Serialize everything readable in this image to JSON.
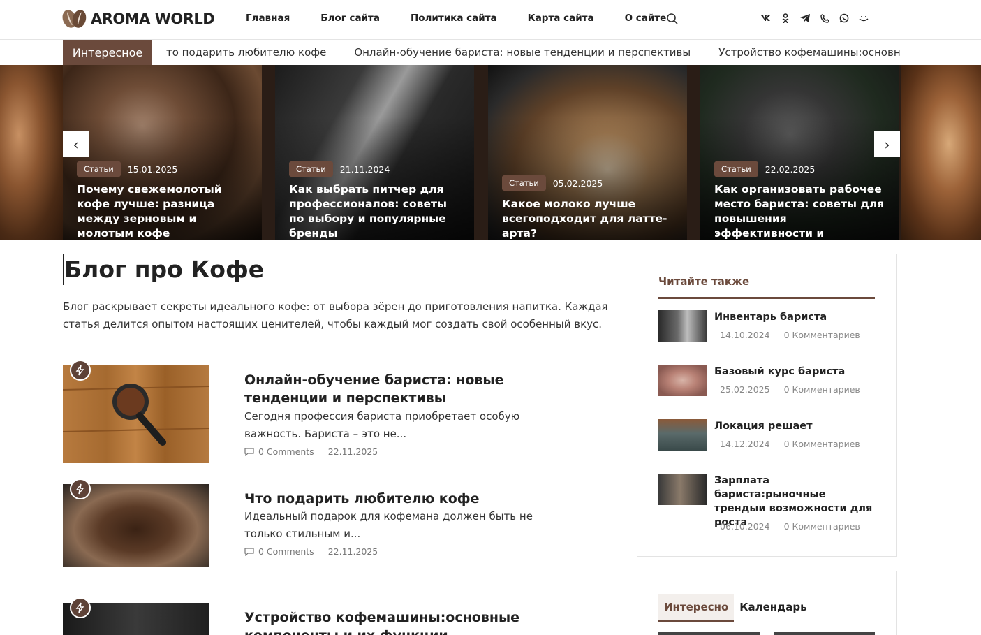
{
  "header": {
    "logo_text": "AROMA WORLD",
    "nav": [
      "Главная",
      "Блог сайта",
      "Политика сайта",
      "Карта сайта",
      "О сайте"
    ],
    "socials": [
      "vk-icon",
      "odnoklassniki-icon",
      "telegram-icon",
      "viber-icon",
      "whatsapp-icon",
      "smile-icon"
    ]
  },
  "ticker": {
    "label": "Интересное",
    "items": [
      "то подарить любителю кофе",
      "Онлайн-обучение бариста: новые тенденции и перспективы",
      "Устройство кофемашины:основные компо"
    ]
  },
  "slider": {
    "slides": [
      {
        "badge": "Статьи",
        "date": "15.01.2025",
        "title": "Почему свежемолотый кофе лучше: разница между зерновым и молотым кофе"
      },
      {
        "badge": "Статьи",
        "date": "21.11.2024",
        "title": "Как выбрать питчер для профессионалов: советы по выбору и популярные бренды"
      },
      {
        "badge": "Статьи",
        "date": "05.02.2025",
        "title": "Какое молоко лучше всегоподходит для латте-арта?"
      },
      {
        "badge": "Статьи",
        "date": "22.02.2025",
        "title": "Как организовать рабочее место бариста: советы для повышения эффективности и"
      }
    ],
    "prev_label": "‹",
    "next_label": "›"
  },
  "main": {
    "title": "Блог про Кофе",
    "description": "Блог раскрывает секреты идеального кофе: от выбора зёрен до приготовления напитка. Каждая статья делится опытом настоящих ценителей, чтобы каждый мог создать свой особенный вкус.",
    "posts": [
      {
        "title": "Онлайн-обучение бариста: новые тенденции и перспективы",
        "excerpt": "Сегодня профессия бариста приобретает особую важность. Бариста – это не...",
        "comments": "0 Comments",
        "date": "22.11.2025"
      },
      {
        "title": "Что подарить любителю кофе",
        "excerpt": "Идеальный подарок для кофемана должен быть не только стильным и...",
        "comments": "0 Comments",
        "date": "22.11.2025"
      },
      {
        "title": "Устройство кофемашины:основные компоненты и их функции",
        "excerpt": "",
        "comments": "",
        "date": ""
      }
    ]
  },
  "sidebar": {
    "read_also_title": "Читайте также",
    "items": [
      {
        "title": "Инвентарь бариста",
        "date": "14.10.2024",
        "comments": "0 Комментариев"
      },
      {
        "title": "Базовый курс бариста",
        "date": "25.02.2025",
        "comments": "0 Комментариев"
      },
      {
        "title": "Локация решает",
        "date": "14.12.2024",
        "comments": "0 Комментариев"
      },
      {
        "title": "Зарплата бариста:рыночные трендыи возможности для роста",
        "date": "06.10.2024",
        "comments": "0 Комментариев"
      }
    ],
    "tabs": [
      "Интересно",
      "Календарь"
    ]
  },
  "colors": {
    "accent": "#6b4a3c",
    "text": "#222222"
  }
}
